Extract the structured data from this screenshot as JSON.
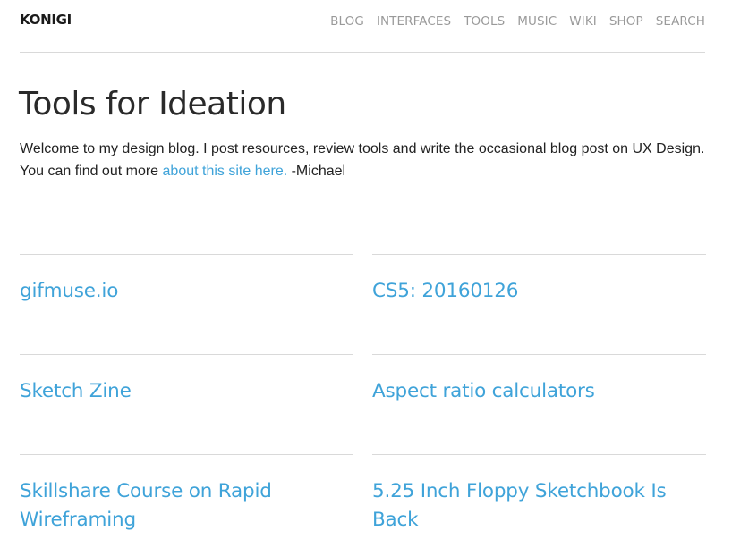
{
  "header": {
    "logo": "KONIGI",
    "nav": [
      "BLOG",
      "INTERFACES",
      "TOOLS",
      "MUSIC",
      "WIKI",
      "SHOP",
      "SEARCH"
    ]
  },
  "page": {
    "title": "Tools for Ideation",
    "intro_line1": "Welcome to my design blog. I post resources, review tools and write the occasional blog post on UX Design.",
    "intro_line2_prefix": "You can find out more ",
    "intro_link": "about this site here.",
    "intro_suffix": " -Michael"
  },
  "posts": [
    "gifmuse.io",
    "CS5: 20160126",
    "Sketch Zine",
    "Aspect ratio calculators",
    "Skillshare Course on Rapid Wireframing",
    "5.25 Inch Floppy Sketchbook Is Back"
  ],
  "colors": {
    "link": "#3fa3d9",
    "nav": "#9a9a9a",
    "divider": "#d9d9d9",
    "text": "#222222"
  }
}
